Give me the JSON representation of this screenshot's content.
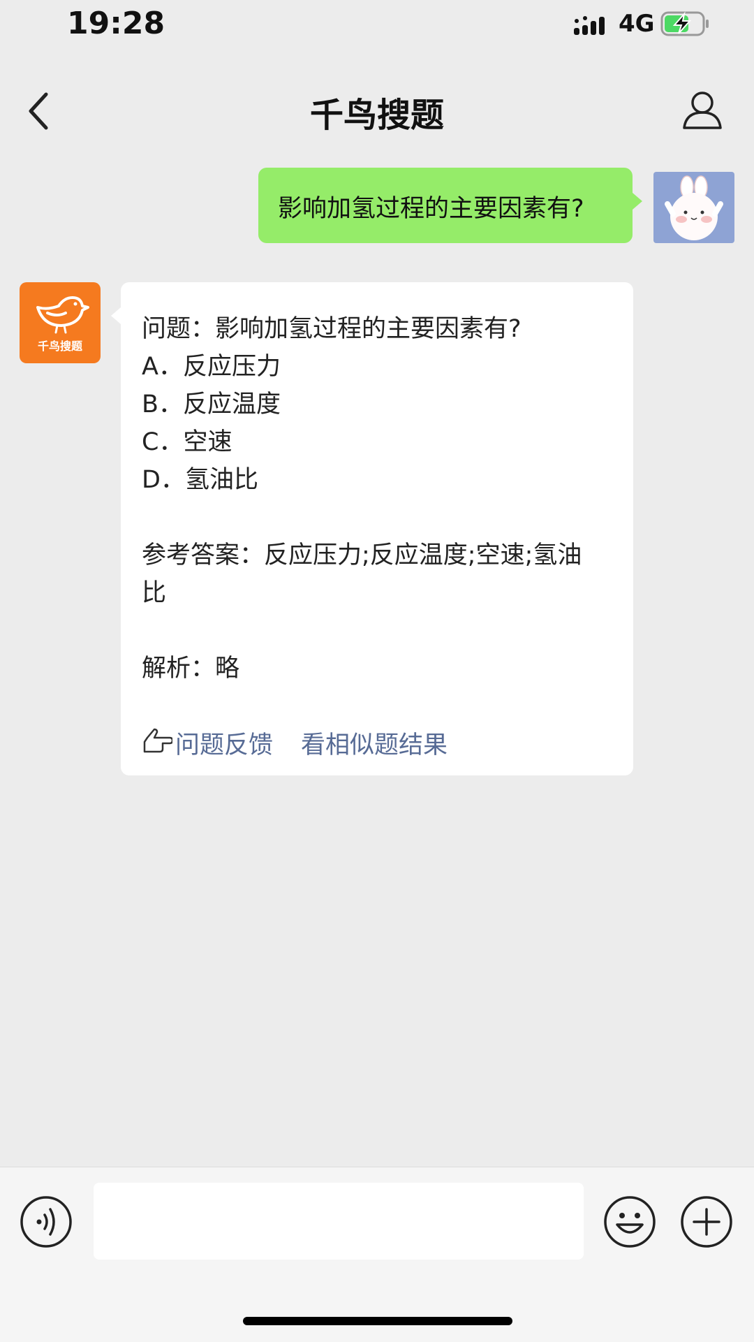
{
  "status_bar": {
    "time": "19:28",
    "network": "4G",
    "icons": [
      "signal-icon",
      "battery-charging-icon"
    ]
  },
  "nav": {
    "title": "千鸟搜题",
    "icons": [
      "back-icon",
      "profile-icon"
    ]
  },
  "user_message": {
    "text": "影响加氢过程的主要因素有?"
  },
  "bot": {
    "avatar_label": "千鸟搜题",
    "avatar_icon": "bird-icon"
  },
  "bot_message": {
    "question": "问题：影响加氢过程的主要因素有?",
    "options": [
      "A．反应压力",
      "B．反应温度",
      "C．空速",
      "D．氢油比"
    ],
    "answer_line1": "参考答案：反应压力;反应温度;空速;氢油",
    "answer_line2": "比",
    "analysis": "解析：略",
    "feedback_link": "问题反馈",
    "similar_link": "看相似题结果"
  },
  "bottom_bar": {
    "input_value": "",
    "icons": [
      "voice-icon",
      "emoji-icon",
      "plus-icon"
    ]
  },
  "colors": {
    "user_bubble": "#95ec69",
    "bot_bubble": "#ffffff",
    "link": "#576b95",
    "brand_orange": "#f57a1f",
    "background": "#ececec"
  }
}
